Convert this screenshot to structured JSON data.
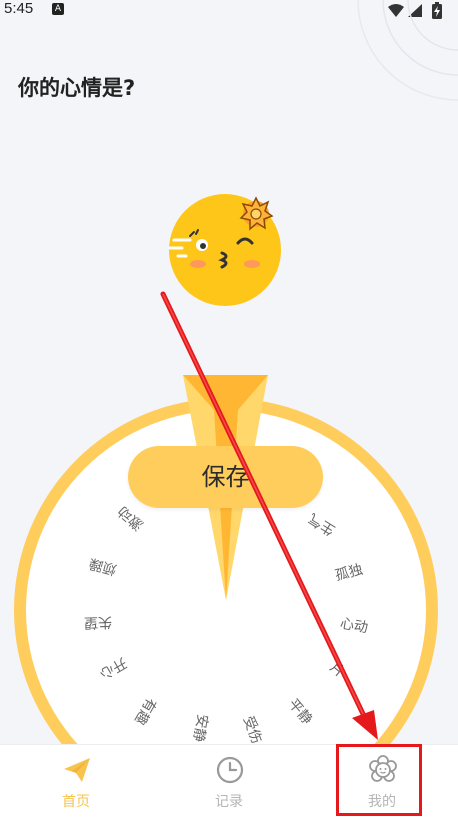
{
  "status_bar": {
    "time": "5:45",
    "notification_glyph": "A",
    "icons": [
      "wifi-icon",
      "signal-icon",
      "battery-charging-icon"
    ]
  },
  "page": {
    "title": "你的心情是?"
  },
  "mood_selector": {
    "selected_mood_icon": "kiss-face-icon",
    "save_label": "保存",
    "moods": [
      "生气",
      "孤独",
      "心动",
      "平静",
      "受伤",
      "安静",
      "有趣",
      "开心",
      "失望",
      "烦躁",
      "激动"
    ],
    "partial_mood_glyph": "片",
    "colors": {
      "ring": "#ffcd5c",
      "pointer": "#ffb733",
      "face": "#ffc61a"
    }
  },
  "tab_bar": {
    "tabs": [
      {
        "label": "首页",
        "icon": "paper-plane-icon",
        "active": true
      },
      {
        "label": "记录",
        "icon": "clock-icon",
        "active": false
      },
      {
        "label": "我的",
        "icon": "flower-face-icon",
        "active": false
      }
    ],
    "colors": {
      "active": "#f8c44f",
      "inactive": "#b5b5b5"
    }
  },
  "annotation": {
    "color": "#e5191b",
    "target": "tab-mine"
  }
}
